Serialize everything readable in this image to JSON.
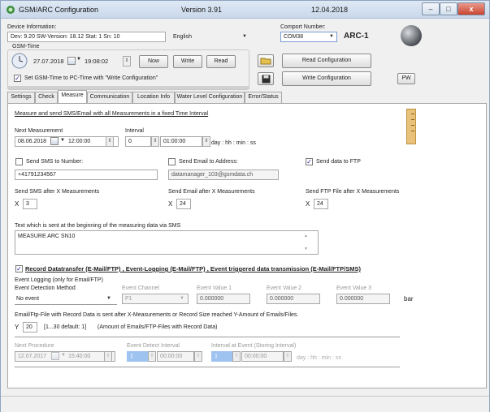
{
  "window": {
    "title": "GSM/ARC Configuration",
    "version": "Version 3.91",
    "date": "12.04.2018",
    "minimize": "–",
    "maximize": "□",
    "close": "x"
  },
  "device": {
    "label": "Device Information:",
    "value": "Dev: 9.20 SW-Version: 18.12 Stat: 1  Sn: 10",
    "language": "English",
    "comport_label": "Comport Number:",
    "comport_value": "COM38",
    "device_name": "ARC-1"
  },
  "gsm_time": {
    "label": "GSM-Time",
    "date": "27.07.2018",
    "time": "19:08:02",
    "now_btn": "Now",
    "write_btn": "Write",
    "read_btn": "Read",
    "sync_label": "Set GSM-Time to PC-Time with \"Write Configuration\"",
    "sync_checked": true
  },
  "config": {
    "read_btn": "Read Configuration",
    "write_btn": "Write Configuration",
    "pw_btn": "PW"
  },
  "tabs": [
    "Settings",
    "Check",
    "Measure",
    "Communication",
    "Location Info",
    "Water Level Configuration",
    "Error/Status"
  ],
  "active_tab": "Measure",
  "measure": {
    "heading": "Measure and send SMS/Email with all Measurements in a fixed Time Interval",
    "next_label": "Next Measurement",
    "next_date": "08.06.2018",
    "next_time": "12:00:00",
    "interval_label": "Interval",
    "interval_days": "0",
    "interval_time": "01:00:00",
    "interval_unit": "day : hh : min : ss",
    "sms_label": "Send SMS to Number:",
    "sms_checked": false,
    "sms_number": "+41791234567",
    "email_label": "Send Email to Address:",
    "email_checked": false,
    "email_address": "datamanager_103@gsmdata.ch",
    "ftp_label": "Send data to FTP",
    "ftp_checked": true,
    "sms_after_label": "Send SMS after X Measurements",
    "sms_after_value": "3",
    "email_after_label": "Send Email after X Measurements",
    "email_after_value": "24",
    "ftp_after_label": "Send FTP File after X Measurements",
    "ftp_after_value": "24",
    "x_symbol": "X",
    "sms_text_label": "Text which is sent at the beginning of the measuring data via SMS",
    "sms_text_value": "MEASURE ARC SN10",
    "scroll_up": "▲",
    "scroll_down": "▼"
  },
  "record": {
    "checked": true,
    "heading": "Record Datatransfer (E-Mail/FTP) ,  Event-Logging (E-Mail/FTP) ,  Event triggered data transmission (E-Mail/FTP/SMS)",
    "event_logging_label": "Event Logging (only for Email/FTP)",
    "method_label": "Event Detection Method",
    "method_value": "No event",
    "channel_label": "Event Channel",
    "channel_value": "P1",
    "value1_label": "Event Value 1",
    "value1": "0.000000",
    "value2_label": "Event Value 2",
    "value2": "0.000000",
    "value3_label": "Event Value 3",
    "value3": "0.000000",
    "unit": "bar",
    "file_label": "Email/Ftp-File with Record Data is sent after X-Measurements or Record Size reached Y-Amount of Emails/Files.",
    "y_symbol": "Y",
    "y_value": "20",
    "y_range": "[1...30  default: 1]",
    "y_desc": "(Amount of Emails/FTP-Files with Record Data)",
    "next_proc_label": "Next Procedure",
    "next_proc_date": "12.07.2017",
    "next_proc_time": "15:40:00",
    "detect_label": "Event Detect Interval",
    "detect_days": "1",
    "detect_time": "00:00:00",
    "storing_label": "Interval at Event (Storing Interval)",
    "storing_days": "1",
    "storing_time": "00:00:00",
    "storing_unit": "day : hh : min : ss"
  },
  "colors": {
    "ruler": "#e8c27a",
    "globe": "#6b7078",
    "accent_text": "#1a1a9a"
  },
  "icons": {
    "app": "gsm-app-icon",
    "clock": "clock-icon",
    "open": "folder-open-icon",
    "save": "floppy-save-icon",
    "globe": "globe-icon",
    "ruler": "ruler-icon",
    "calendar": "calendar-icon",
    "spin": "spin-arrows-icon",
    "dropdown": "chevron-down-icon"
  }
}
